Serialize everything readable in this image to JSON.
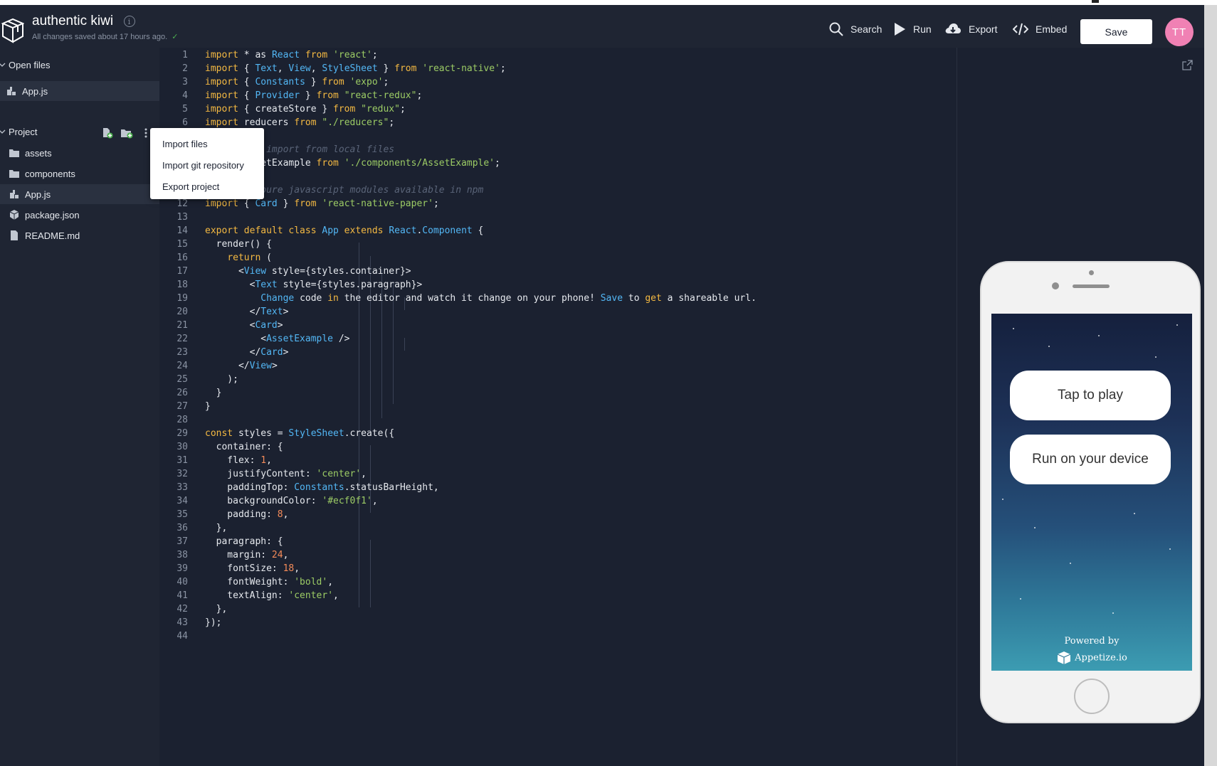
{
  "header": {
    "app_title": "authentic kiwi",
    "save_status": "All changes saved about 17 hours ago.",
    "buttons": {
      "search": "Search",
      "run": "Run",
      "export": "Export",
      "embed": "Embed",
      "save": "Save"
    },
    "avatar_initials": "TT"
  },
  "sidebar": {
    "open_files_label": "Open files",
    "open_files": [
      "App.js"
    ],
    "project_label": "Project",
    "project_items": [
      {
        "name": "assets",
        "type": "folder"
      },
      {
        "name": "components",
        "type": "folder"
      },
      {
        "name": "App.js",
        "type": "js"
      },
      {
        "name": "package.json",
        "type": "package"
      },
      {
        "name": "README.md",
        "type": "doc"
      }
    ]
  },
  "dropdown": {
    "items": [
      "Import files",
      "Import git repository",
      "Export project"
    ]
  },
  "editor": {
    "line_numbers": [
      "1",
      "2",
      "3",
      "4",
      "5",
      "6",
      "7",
      "8",
      "9",
      "10",
      "11",
      "12",
      "13",
      "14",
      "15",
      "16",
      "17",
      "18",
      "19",
      "20",
      "21",
      "22",
      "23",
      "24",
      "25",
      "26",
      "27",
      "28",
      "29",
      "30",
      "31",
      "32",
      "33",
      "34",
      "35",
      "36",
      "37",
      "38",
      "39",
      "40",
      "41",
      "42",
      "43",
      "44"
    ]
  },
  "preview": {
    "tap_to_play": "Tap to play",
    "run_on_device": "Run on your device",
    "powered_by": "Powered by",
    "appetize": "Appetize.io"
  },
  "colors": {
    "background": "#1b2130",
    "panel": "#1f2533",
    "keyword": "#f4b942",
    "identifier": "#53b7f5",
    "string": "#9ccc65",
    "number": "#f48b59",
    "avatar": "#f081b4"
  }
}
